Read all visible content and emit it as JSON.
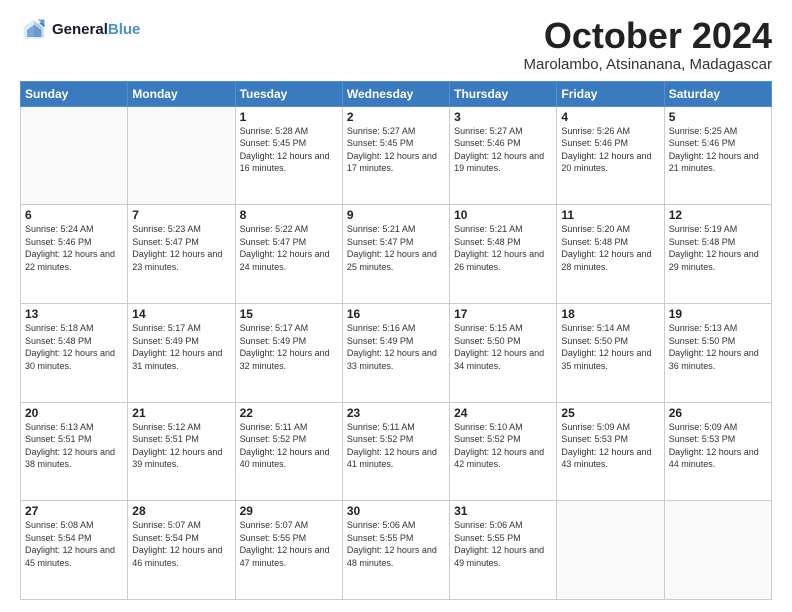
{
  "logo": {
    "line1": "General",
    "line2": "Blue"
  },
  "header": {
    "month": "October 2024",
    "location": "Marolambo, Atsinanana, Madagascar"
  },
  "weekdays": [
    "Sunday",
    "Monday",
    "Tuesday",
    "Wednesday",
    "Thursday",
    "Friday",
    "Saturday"
  ],
  "weeks": [
    [
      {
        "day": "",
        "sunrise": "",
        "sunset": "",
        "daylight": ""
      },
      {
        "day": "",
        "sunrise": "",
        "sunset": "",
        "daylight": ""
      },
      {
        "day": "1",
        "sunrise": "Sunrise: 5:28 AM",
        "sunset": "Sunset: 5:45 PM",
        "daylight": "Daylight: 12 hours and 16 minutes."
      },
      {
        "day": "2",
        "sunrise": "Sunrise: 5:27 AM",
        "sunset": "Sunset: 5:45 PM",
        "daylight": "Daylight: 12 hours and 17 minutes."
      },
      {
        "day": "3",
        "sunrise": "Sunrise: 5:27 AM",
        "sunset": "Sunset: 5:46 PM",
        "daylight": "Daylight: 12 hours and 19 minutes."
      },
      {
        "day": "4",
        "sunrise": "Sunrise: 5:26 AM",
        "sunset": "Sunset: 5:46 PM",
        "daylight": "Daylight: 12 hours and 20 minutes."
      },
      {
        "day": "5",
        "sunrise": "Sunrise: 5:25 AM",
        "sunset": "Sunset: 5:46 PM",
        "daylight": "Daylight: 12 hours and 21 minutes."
      }
    ],
    [
      {
        "day": "6",
        "sunrise": "Sunrise: 5:24 AM",
        "sunset": "Sunset: 5:46 PM",
        "daylight": "Daylight: 12 hours and 22 minutes."
      },
      {
        "day": "7",
        "sunrise": "Sunrise: 5:23 AM",
        "sunset": "Sunset: 5:47 PM",
        "daylight": "Daylight: 12 hours and 23 minutes."
      },
      {
        "day": "8",
        "sunrise": "Sunrise: 5:22 AM",
        "sunset": "Sunset: 5:47 PM",
        "daylight": "Daylight: 12 hours and 24 minutes."
      },
      {
        "day": "9",
        "sunrise": "Sunrise: 5:21 AM",
        "sunset": "Sunset: 5:47 PM",
        "daylight": "Daylight: 12 hours and 25 minutes."
      },
      {
        "day": "10",
        "sunrise": "Sunrise: 5:21 AM",
        "sunset": "Sunset: 5:48 PM",
        "daylight": "Daylight: 12 hours and 26 minutes."
      },
      {
        "day": "11",
        "sunrise": "Sunrise: 5:20 AM",
        "sunset": "Sunset: 5:48 PM",
        "daylight": "Daylight: 12 hours and 28 minutes."
      },
      {
        "day": "12",
        "sunrise": "Sunrise: 5:19 AM",
        "sunset": "Sunset: 5:48 PM",
        "daylight": "Daylight: 12 hours and 29 minutes."
      }
    ],
    [
      {
        "day": "13",
        "sunrise": "Sunrise: 5:18 AM",
        "sunset": "Sunset: 5:48 PM",
        "daylight": "Daylight: 12 hours and 30 minutes."
      },
      {
        "day": "14",
        "sunrise": "Sunrise: 5:17 AM",
        "sunset": "Sunset: 5:49 PM",
        "daylight": "Daylight: 12 hours and 31 minutes."
      },
      {
        "day": "15",
        "sunrise": "Sunrise: 5:17 AM",
        "sunset": "Sunset: 5:49 PM",
        "daylight": "Daylight: 12 hours and 32 minutes."
      },
      {
        "day": "16",
        "sunrise": "Sunrise: 5:16 AM",
        "sunset": "Sunset: 5:49 PM",
        "daylight": "Daylight: 12 hours and 33 minutes."
      },
      {
        "day": "17",
        "sunrise": "Sunrise: 5:15 AM",
        "sunset": "Sunset: 5:50 PM",
        "daylight": "Daylight: 12 hours and 34 minutes."
      },
      {
        "day": "18",
        "sunrise": "Sunrise: 5:14 AM",
        "sunset": "Sunset: 5:50 PM",
        "daylight": "Daylight: 12 hours and 35 minutes."
      },
      {
        "day": "19",
        "sunrise": "Sunrise: 5:13 AM",
        "sunset": "Sunset: 5:50 PM",
        "daylight": "Daylight: 12 hours and 36 minutes."
      }
    ],
    [
      {
        "day": "20",
        "sunrise": "Sunrise: 5:13 AM",
        "sunset": "Sunset: 5:51 PM",
        "daylight": "Daylight: 12 hours and 38 minutes."
      },
      {
        "day": "21",
        "sunrise": "Sunrise: 5:12 AM",
        "sunset": "Sunset: 5:51 PM",
        "daylight": "Daylight: 12 hours and 39 minutes."
      },
      {
        "day": "22",
        "sunrise": "Sunrise: 5:11 AM",
        "sunset": "Sunset: 5:52 PM",
        "daylight": "Daylight: 12 hours and 40 minutes."
      },
      {
        "day": "23",
        "sunrise": "Sunrise: 5:11 AM",
        "sunset": "Sunset: 5:52 PM",
        "daylight": "Daylight: 12 hours and 41 minutes."
      },
      {
        "day": "24",
        "sunrise": "Sunrise: 5:10 AM",
        "sunset": "Sunset: 5:52 PM",
        "daylight": "Daylight: 12 hours and 42 minutes."
      },
      {
        "day": "25",
        "sunrise": "Sunrise: 5:09 AM",
        "sunset": "Sunset: 5:53 PM",
        "daylight": "Daylight: 12 hours and 43 minutes."
      },
      {
        "day": "26",
        "sunrise": "Sunrise: 5:09 AM",
        "sunset": "Sunset: 5:53 PM",
        "daylight": "Daylight: 12 hours and 44 minutes."
      }
    ],
    [
      {
        "day": "27",
        "sunrise": "Sunrise: 5:08 AM",
        "sunset": "Sunset: 5:54 PM",
        "daylight": "Daylight: 12 hours and 45 minutes."
      },
      {
        "day": "28",
        "sunrise": "Sunrise: 5:07 AM",
        "sunset": "Sunset: 5:54 PM",
        "daylight": "Daylight: 12 hours and 46 minutes."
      },
      {
        "day": "29",
        "sunrise": "Sunrise: 5:07 AM",
        "sunset": "Sunset: 5:55 PM",
        "daylight": "Daylight: 12 hours and 47 minutes."
      },
      {
        "day": "30",
        "sunrise": "Sunrise: 5:06 AM",
        "sunset": "Sunset: 5:55 PM",
        "daylight": "Daylight: 12 hours and 48 minutes."
      },
      {
        "day": "31",
        "sunrise": "Sunrise: 5:06 AM",
        "sunset": "Sunset: 5:55 PM",
        "daylight": "Daylight: 12 hours and 49 minutes."
      },
      {
        "day": "",
        "sunrise": "",
        "sunset": "",
        "daylight": ""
      },
      {
        "day": "",
        "sunrise": "",
        "sunset": "",
        "daylight": ""
      }
    ]
  ]
}
